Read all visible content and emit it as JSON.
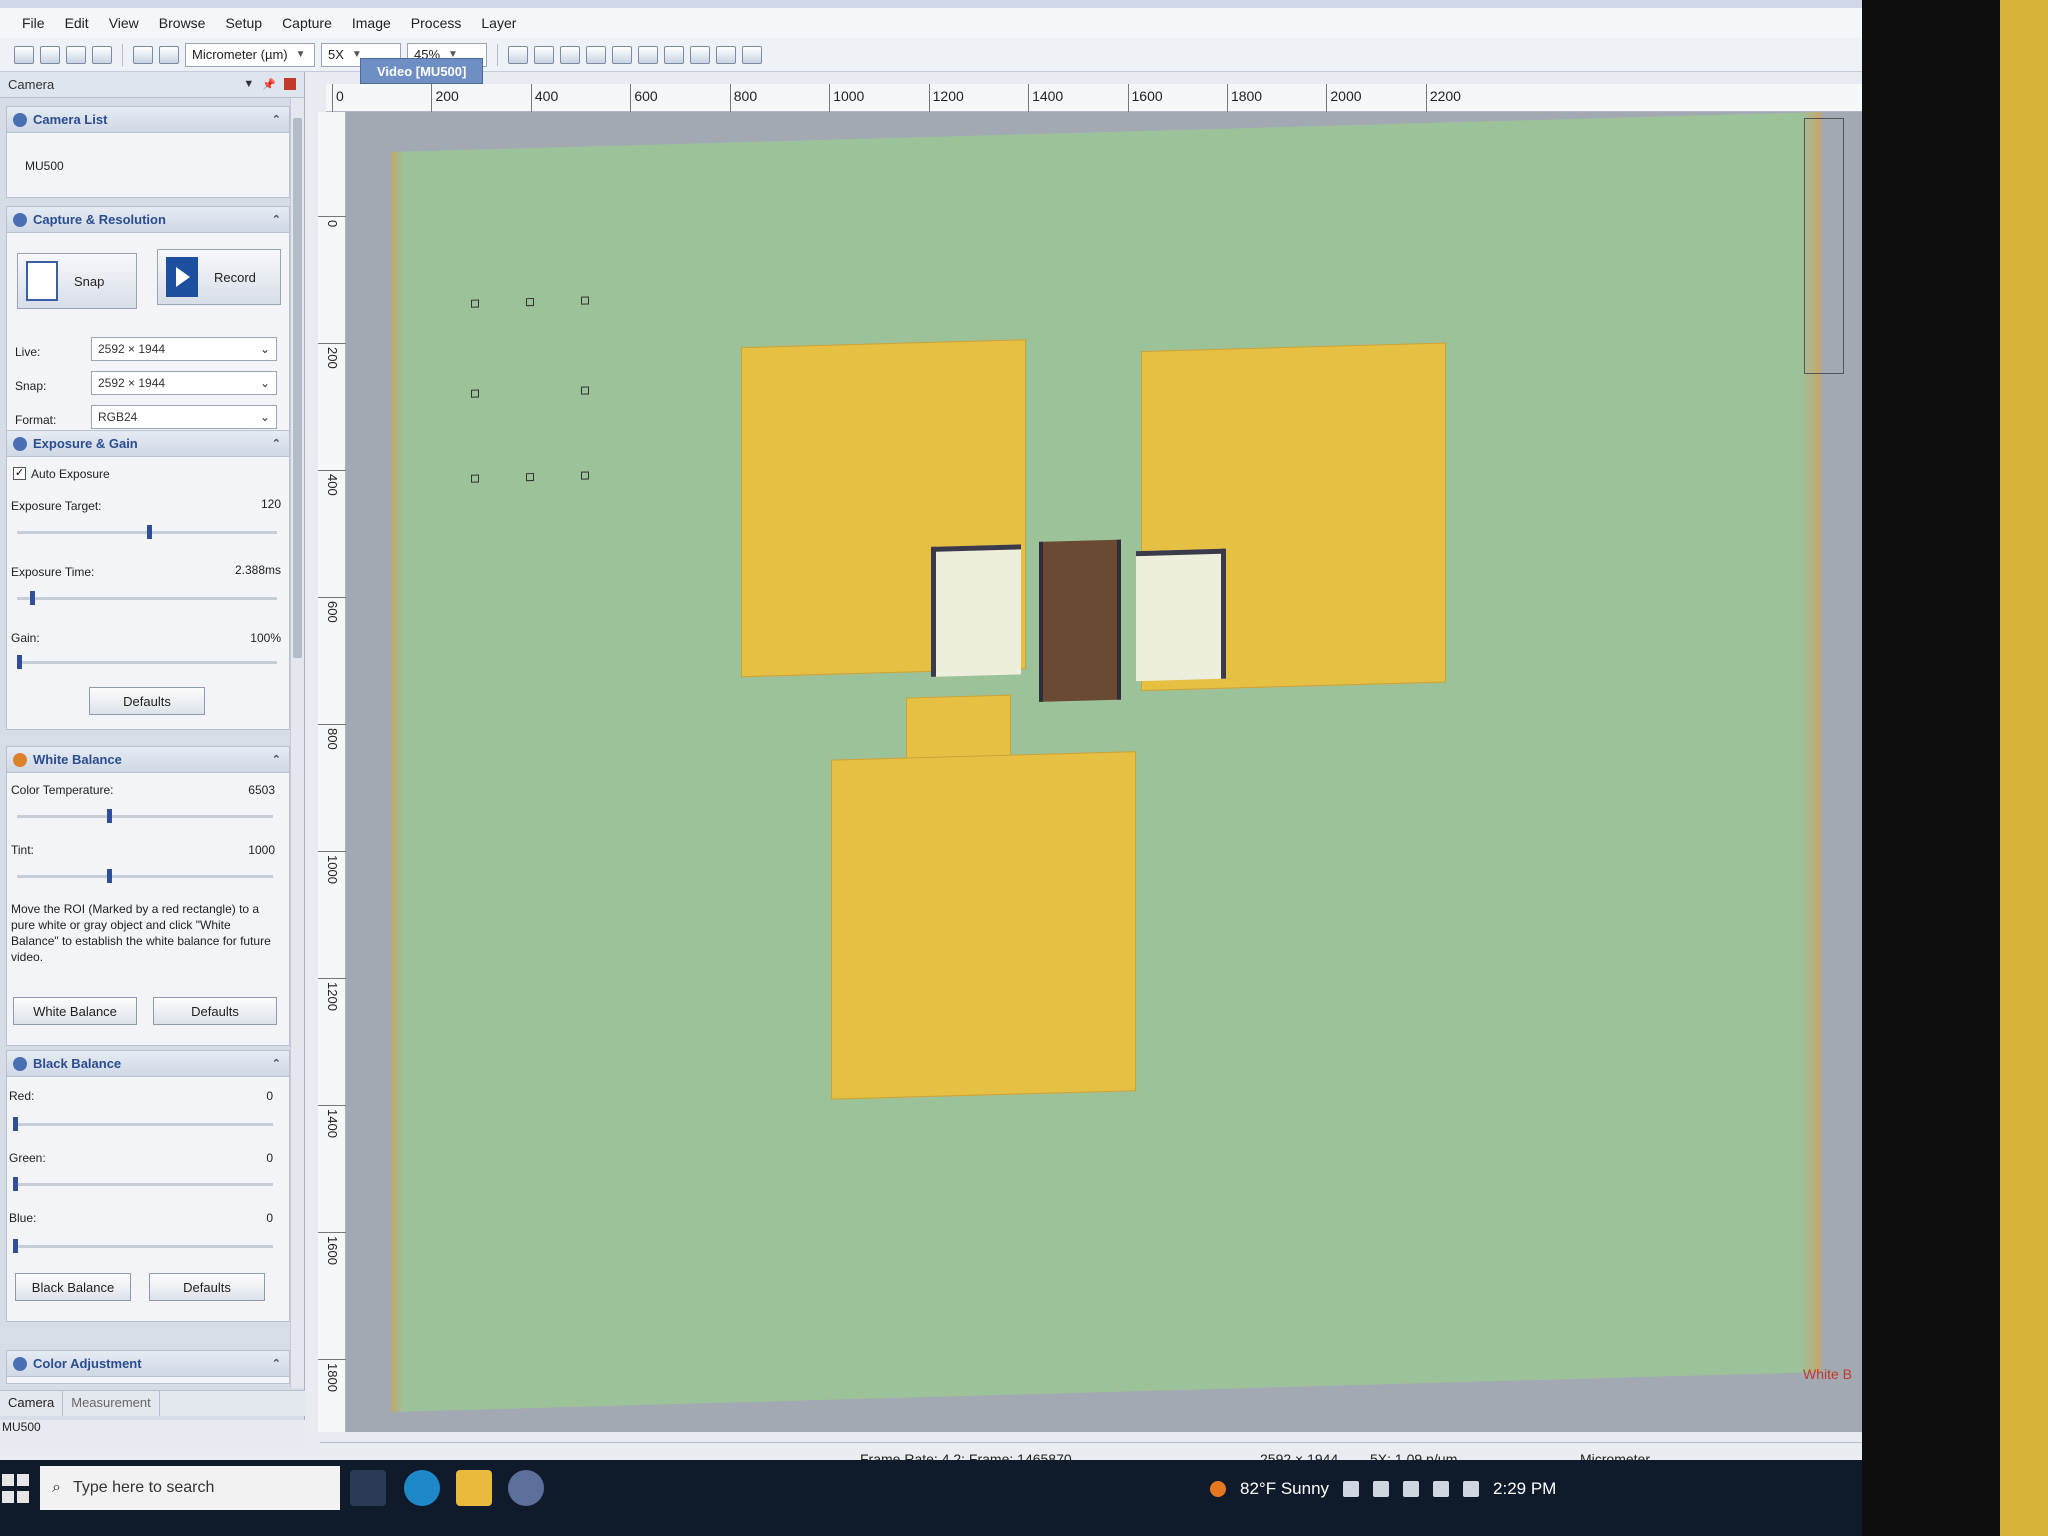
{
  "menu": [
    "File",
    "Edit",
    "View",
    "Browse",
    "Setup",
    "Capture",
    "Image",
    "Process",
    "Layer"
  ],
  "toolbar": {
    "unit": "Micrometer (µm)",
    "objective": "5X",
    "zoom": "45%"
  },
  "panel": {
    "title": "Camera"
  },
  "camera_list": {
    "title": "Camera List",
    "camera": "MU500"
  },
  "capture": {
    "title": "Capture & Resolution",
    "snap_label": "Snap",
    "record_label": "Record",
    "live_label": "Live:",
    "live_value": "2592 × 1944",
    "snap_res_label": "Snap:",
    "snap_value": "2592 × 1944",
    "format_label": "Format:",
    "format_value": "RGB24"
  },
  "exposure": {
    "title": "Exposure & Gain",
    "auto_label": "Auto Exposure",
    "auto_checked": true,
    "target_label": "Exposure Target:",
    "target_value": "120",
    "target_fraction": 0.5,
    "time_label": "Exposure Time:",
    "time_value": "2.388ms",
    "time_fraction": 0.05,
    "gain_label": "Gain:",
    "gain_value": "100%",
    "gain_fraction": 0.0,
    "defaults_label": "Defaults"
  },
  "white_balance": {
    "title": "White Balance",
    "temp_label": "Color Temperature:",
    "temp_value": "6503",
    "temp_fraction": 0.35,
    "tint_label": "Tint:",
    "tint_value": "1000",
    "tint_fraction": 0.35,
    "note": "Move the ROI (Marked by a red rectangle) to a pure white or gray object and click \"White Balance\" to establish the white balance for future video.",
    "wb_button": "White Balance",
    "defaults_label": "Defaults"
  },
  "black_balance": {
    "title": "Black Balance",
    "red_label": "Red:",
    "red_value": "0",
    "green_label": "Green:",
    "green_value": "0",
    "blue_label": "Blue:",
    "blue_value": "0",
    "bb_button": "Black Balance",
    "defaults_label": "Defaults"
  },
  "color_adjustment": {
    "title": "Color Adjustment"
  },
  "bottom_tabs": [
    "Camera",
    "Measurement"
  ],
  "left_status": "MU500",
  "doc_tab": "Video [MU500]",
  "ruler_h": [
    "0",
    "200",
    "400",
    "600",
    "800",
    "1000",
    "1200",
    "1400",
    "1600",
    "1800",
    "2000",
    "2200"
  ],
  "ruler_v": [
    "0",
    "200",
    "400",
    "600",
    "800",
    "1000",
    "1200",
    "1400",
    "1600",
    "1800"
  ],
  "canvas": {
    "wb_roi_label": "White B"
  },
  "status": {
    "frame": "Frame Rate: 4.2; Frame: 1465870",
    "resolution": "2592 × 1944",
    "scale": "5X: 1.09 p/µm",
    "unit": "Micrometer"
  },
  "taskbar": {
    "search_placeholder": "Type here to search",
    "weather": "82°F  Sunny",
    "time": "2:29 PM"
  },
  "colors": {
    "sample_bg": "#9cc29a",
    "pad": "#e6c043",
    "accent": "#2a4d8f"
  }
}
